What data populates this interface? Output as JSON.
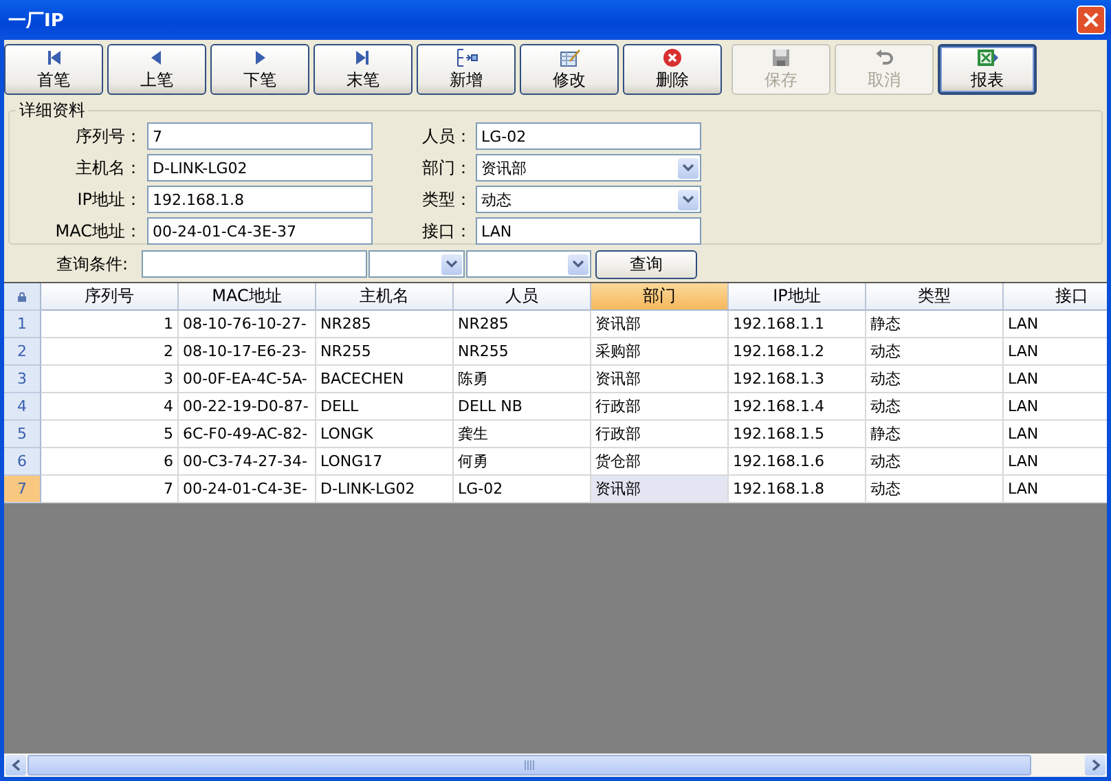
{
  "window": {
    "title": "一厂IP"
  },
  "toolbar": [
    {
      "label": "首笔",
      "kind": "first",
      "disabled": false,
      "selected": false
    },
    {
      "label": "上笔",
      "kind": "prev",
      "disabled": false,
      "selected": false
    },
    {
      "label": "下笔",
      "kind": "next",
      "disabled": false,
      "selected": false
    },
    {
      "label": "末笔",
      "kind": "last",
      "disabled": false,
      "selected": false
    },
    {
      "label": "新增",
      "kind": "new",
      "disabled": false,
      "selected": false
    },
    {
      "label": "修改",
      "kind": "edit",
      "disabled": false,
      "selected": false
    },
    {
      "label": "删除",
      "kind": "delete",
      "disabled": false,
      "selected": false
    },
    {
      "label": "保存",
      "kind": "save",
      "disabled": true,
      "selected": false
    },
    {
      "label": "取消",
      "kind": "cancel",
      "disabled": true,
      "selected": false
    },
    {
      "label": "报表",
      "kind": "report",
      "disabled": false,
      "selected": true
    }
  ],
  "details": {
    "title": "详细资料",
    "left": [
      {
        "label": "序列号：",
        "value": "7",
        "kind": "text"
      },
      {
        "label": "主机名：",
        "value": "D-LINK-LG02",
        "kind": "text"
      },
      {
        "label": "IP地址：",
        "value": "192.168.1.8",
        "kind": "text"
      },
      {
        "label": "MAC地址：",
        "value": "00-24-01-C4-3E-37",
        "kind": "text"
      }
    ],
    "right": [
      {
        "label": "人员：",
        "value": "LG-02",
        "kind": "text"
      },
      {
        "label": "部门：",
        "value": "资讯部",
        "kind": "combo"
      },
      {
        "label": "类型：",
        "value": "动态",
        "kind": "combo"
      },
      {
        "label": "接口：",
        "value": "LAN",
        "kind": "text"
      }
    ]
  },
  "query": {
    "label": "查询条件:",
    "button": "查询"
  },
  "table": {
    "columns": [
      {
        "label": "序列号",
        "selected": false
      },
      {
        "label": "MAC地址",
        "selected": false
      },
      {
        "label": "主机名",
        "selected": false
      },
      {
        "label": "人员",
        "selected": false
      },
      {
        "label": "部门",
        "selected": true
      },
      {
        "label": "IP地址",
        "selected": false
      },
      {
        "label": "类型",
        "selected": false
      },
      {
        "label": "接口",
        "selected": false
      }
    ],
    "rows": [
      {
        "number": "1",
        "selected": false,
        "cells": [
          "1",
          "08-10-76-10-27-",
          "NR285",
          "NR285",
          "资讯部",
          "192.168.1.1",
          "静态",
          "LAN"
        ]
      },
      {
        "number": "2",
        "selected": false,
        "cells": [
          "2",
          "08-10-17-E6-23-",
          "NR255",
          "NR255",
          "采购部",
          "192.168.1.2",
          "动态",
          "LAN"
        ]
      },
      {
        "number": "3",
        "selected": false,
        "cells": [
          "3",
          "00-0F-EA-4C-5A-",
          "BACECHEN",
          "陈勇",
          "资讯部",
          "192.168.1.3",
          "动态",
          "LAN"
        ]
      },
      {
        "number": "4",
        "selected": false,
        "cells": [
          "4",
          "00-22-19-D0-87-",
          "DELL",
          "DELL NB",
          "行政部",
          "192.168.1.4",
          "动态",
          "LAN"
        ]
      },
      {
        "number": "5",
        "selected": false,
        "cells": [
          "5",
          "6C-F0-49-AC-82-",
          "LONGK",
          "龚生",
          "行政部",
          "192.168.1.5",
          "静态",
          "LAN"
        ]
      },
      {
        "number": "6",
        "selected": false,
        "cells": [
          "6",
          "00-C3-74-27-34-",
          "LONG17",
          "何勇",
          "货仓部",
          "192.168.1.6",
          "动态",
          "LAN"
        ]
      },
      {
        "number": "7",
        "selected": true,
        "cells": [
          "7",
          "00-24-01-C4-3E-",
          "D-LINK-LG02",
          "LG-02",
          "资讯部",
          "192.168.1.8",
          "动态",
          "LAN"
        ]
      }
    ]
  }
}
